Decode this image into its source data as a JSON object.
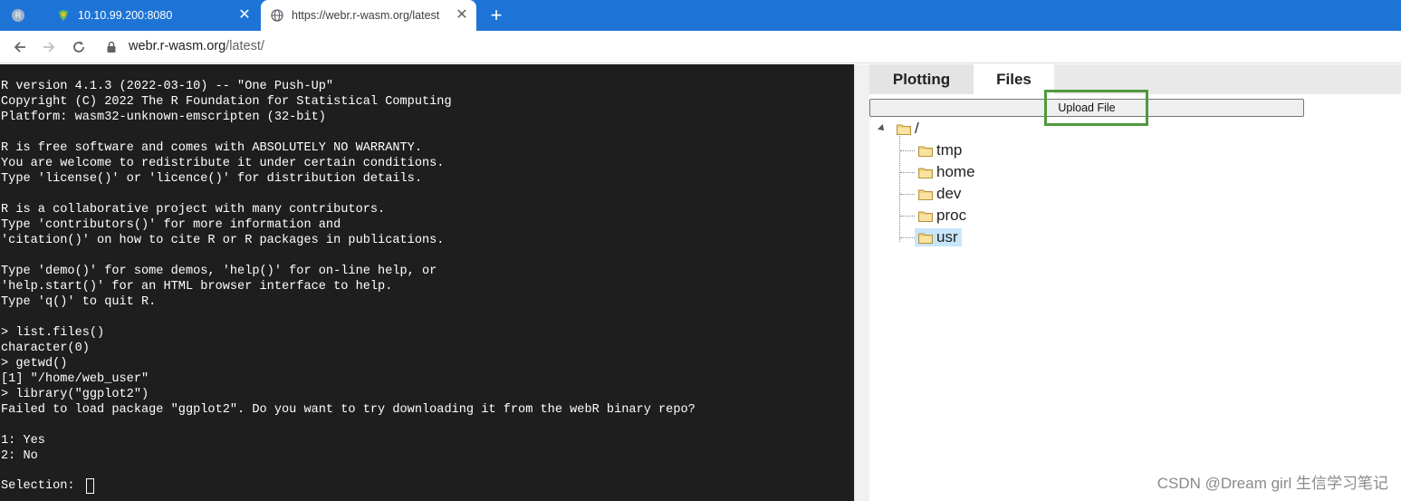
{
  "browser": {
    "tabs": [
      {
        "title": "R",
        "active": false
      },
      {
        "title": "10.10.99.200:8080",
        "active": false
      },
      {
        "title": "https://webr.r-wasm.org/latest",
        "active": true
      }
    ],
    "close_glyph": "✕",
    "new_tab_glyph": "+",
    "url_host": "webr.r-wasm.org",
    "url_path": "/latest/",
    "colors": {
      "tabbar": "#1e74d6"
    }
  },
  "console": {
    "text": "R version 4.1.3 (2022-03-10) -- \"One Push-Up\"\nCopyright (C) 2022 The R Foundation for Statistical Computing\nPlatform: wasm32-unknown-emscripten (32-bit)\n\nR is free software and comes with ABSOLUTELY NO WARRANTY.\nYou are welcome to redistribute it under certain conditions.\nType 'license()' or 'licence()' for distribution details.\n\nR is a collaborative project with many contributors.\nType 'contributors()' for more information and\n'citation()' on how to cite R or R packages in publications.\n\nType 'demo()' for some demos, 'help()' for on-line help, or\n'help.start()' for an HTML browser interface to help.\nType 'q()' to quit R.\n\n> list.files()\ncharacter(0)\n> getwd()\n[1] \"/home/web_user\"\n> library(\"ggplot2\")\nFailed to load package \"ggplot2\". Do you want to try downloading it from the webR binary repo?\n\n1: Yes\n2: No",
    "prompt": "Selection: ",
    "colors": {
      "background": "#1e1e1e",
      "text": "#ffffff"
    }
  },
  "panel": {
    "tabs": {
      "plotting": "Plotting",
      "files": "Files"
    },
    "active_tab": "Files",
    "upload_label": "Upload File",
    "tree": {
      "root": "/",
      "children": [
        "tmp",
        "home",
        "dev",
        "proc",
        "usr"
      ],
      "selected": "usr"
    },
    "colors": {
      "highlight_box": "#4f9a3d",
      "selection": "#c8e6fb"
    }
  },
  "watermark": "CSDN @Dream girl 生信学习笔记"
}
